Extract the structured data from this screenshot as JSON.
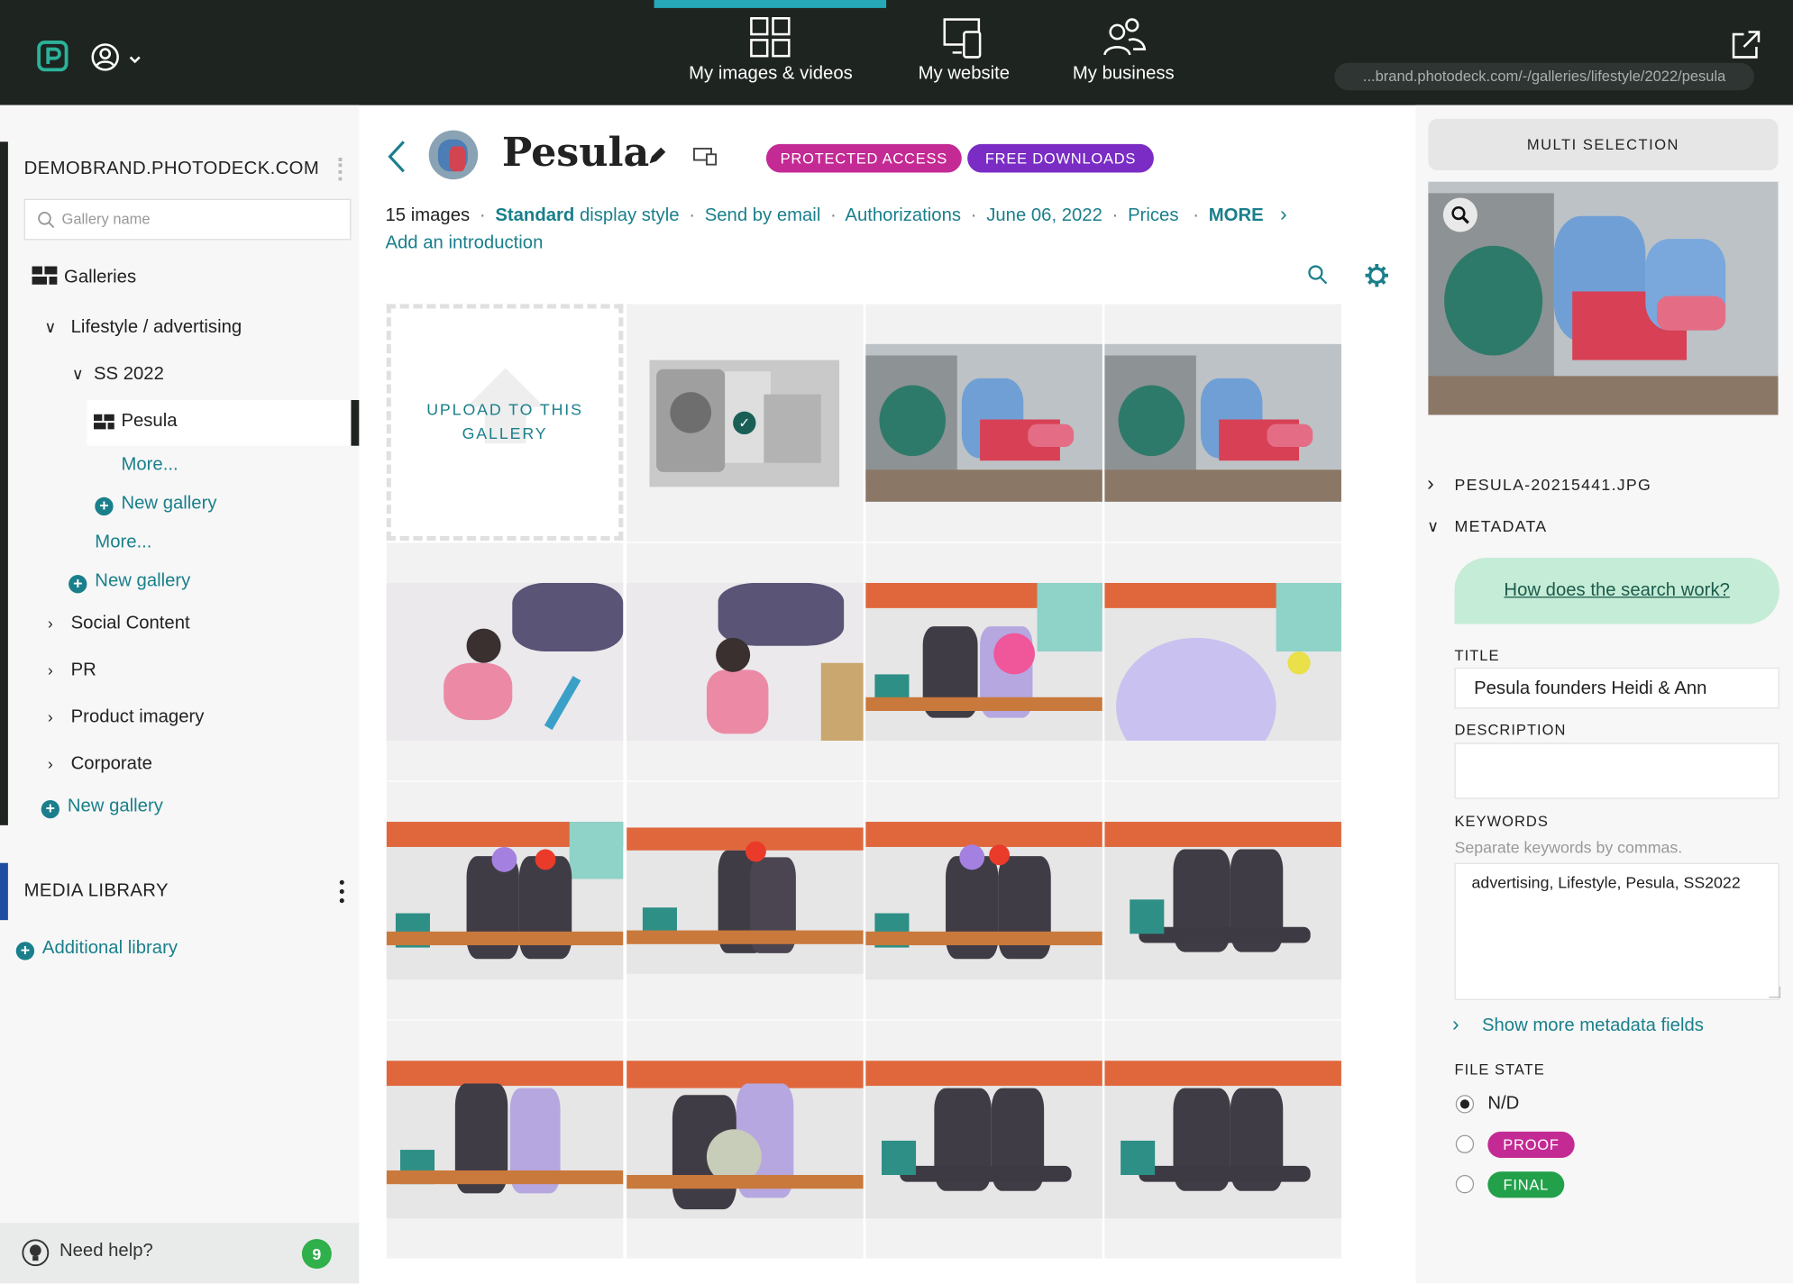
{
  "nav": {
    "items": [
      {
        "label": "My images & videos",
        "icon": "grid-icon"
      },
      {
        "label": "My website",
        "icon": "devices-icon"
      },
      {
        "label": "My business",
        "icon": "people-icon"
      }
    ],
    "url": "...brand.photodeck.com/-/galleries/lifestyle/2022/pesula"
  },
  "sidebar": {
    "site": "DEMOBRAND.PHOTODECK.COM",
    "search_placeholder": "Gallery name",
    "galleries_label": "Galleries",
    "tree": {
      "lifestyle": "Lifestyle / advertising",
      "ss2022": "SS 2022",
      "pesula": "Pesula",
      "more_inner": "More...",
      "new_gallery_inner": "New gallery",
      "more_outer": "More...",
      "new_gallery_mid": "New gallery",
      "social": "Social Content",
      "pr": "PR",
      "product": "Product imagery",
      "corporate": "Corporate",
      "new_gallery_top": "New gallery"
    },
    "media_library": "MEDIA LIBRARY",
    "additional_library": "Additional library",
    "help": "Need help?",
    "help_count": "9"
  },
  "gallery": {
    "title": "Pesula",
    "badges": [
      "PROTECTED ACCESS",
      "FREE DOWNLOADS"
    ],
    "image_count": "15 images",
    "display_style_bold": "Standard",
    "display_style": "display style",
    "send_email": "Send by email",
    "authorizations": "Authorizations",
    "date": "June 06, 2022",
    "prices": "Prices",
    "more": "MORE",
    "intro": "Add an introduction",
    "upload": "UPLOAD TO THIS GALLERY"
  },
  "panel": {
    "multi_selection": "MULTI SELECTION",
    "filename": "PESULA-20215441.JPG",
    "metadata": "METADATA",
    "search_help": "How does the search work?",
    "title_label": "TITLE",
    "title_value": "Pesula founders Heidi & Ann",
    "description_label": "DESCRIPTION",
    "keywords_label": "KEYWORDS",
    "keywords_hint": "Separate keywords by commas.",
    "keywords_value": "advertising, Lifestyle, Pesula, SS2022",
    "show_more": "Show more metadata fields",
    "file_state_label": "FILE STATE",
    "file_states": [
      "N/D",
      "PROOF",
      "FINAL"
    ]
  },
  "colors": {
    "topbar": "#1e2420",
    "accent": "#26a8b8",
    "link": "#1a7f8b",
    "protected": "#c42a94",
    "downloads": "#7a2cc4",
    "final": "#22a04a",
    "help_bubble": "#c5ecd6"
  }
}
